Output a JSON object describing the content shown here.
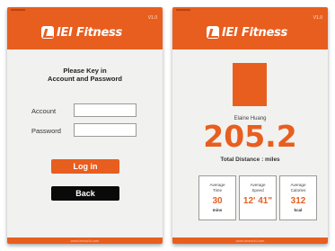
{
  "login_screen": {
    "version": "V1.0",
    "brand": "IEI Fitness",
    "heading_line1": "Please Key in",
    "heading_line2": "Account and Password",
    "account_label": "Account",
    "account_value": "",
    "password_label": "Password",
    "password_value": "",
    "login_button": "Log in",
    "back_button": "Back",
    "footer": "www.ieiworld.com"
  },
  "stats_screen": {
    "version": "V1.0",
    "brand": "IEI Fitness",
    "user_name": "Elaine Huang",
    "distance": "205.2",
    "distance_label": "Total Distance : miles",
    "stats": [
      {
        "label_line1": "Average",
        "label_line2": "Time",
        "value": "30",
        "unit": "mins"
      },
      {
        "label_line1": "Average",
        "label_line2": "Speed",
        "value": "12' 41\"",
        "unit": ""
      },
      {
        "label_line1": "Average",
        "label_line2": "Calories",
        "value": "312",
        "unit": "kcal"
      }
    ],
    "footer": "www.ieiworld.com"
  },
  "colors": {
    "accent": "#e85e1f",
    "dark_button": "#0a0a0a",
    "background": "#f1f1ef"
  }
}
